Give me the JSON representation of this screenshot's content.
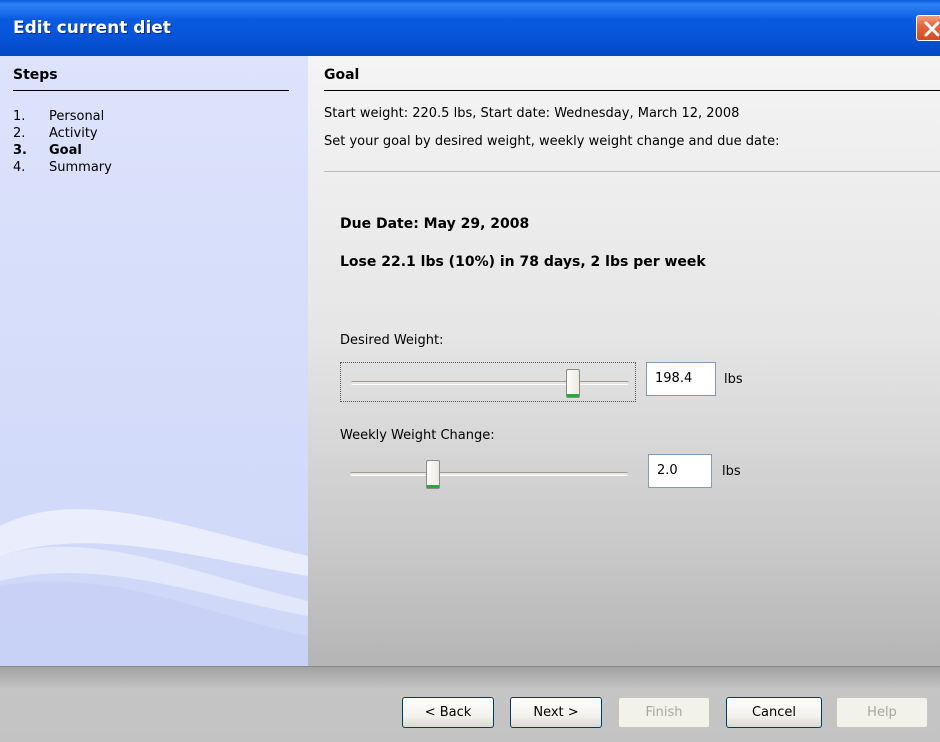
{
  "window": {
    "title": "Edit current diet",
    "close_icon": "close-icon"
  },
  "sidebar": {
    "heading": "Steps",
    "steps": [
      {
        "num": "1.",
        "label": "Personal",
        "active": false
      },
      {
        "num": "2.",
        "label": "Activity",
        "active": false
      },
      {
        "num": "3.",
        "label": "Goal",
        "active": true
      },
      {
        "num": "4.",
        "label": "Summary",
        "active": false
      }
    ]
  },
  "goal": {
    "heading": "Goal",
    "start_info": "Start weight: 220.5 lbs, Start date: Wednesday, March 12, 2008",
    "instruction": "Set your goal by desired weight, weekly weight change and due date:",
    "due_date": "Due Date: May 29, 2008",
    "lose_summary": "Lose 22.1 lbs (10%) in 78 days, 2 lbs per week",
    "desired_weight": {
      "label": "Desired Weight:",
      "value": "198.4",
      "unit": "lbs",
      "slider_fraction": 0.8
    },
    "weekly_change": {
      "label": "Weekly Weight Change:",
      "value": "2.0",
      "unit": "lbs",
      "slider_fraction": 0.3
    }
  },
  "buttons": {
    "back": "< Back",
    "next": "Next >",
    "finish": "Finish",
    "cancel": "Cancel",
    "help": "Help"
  },
  "colors": {
    "titlebar": "#0653d6",
    "sidebar_bg": "#d4dcfa",
    "slider_accent": "#2fa53a"
  }
}
